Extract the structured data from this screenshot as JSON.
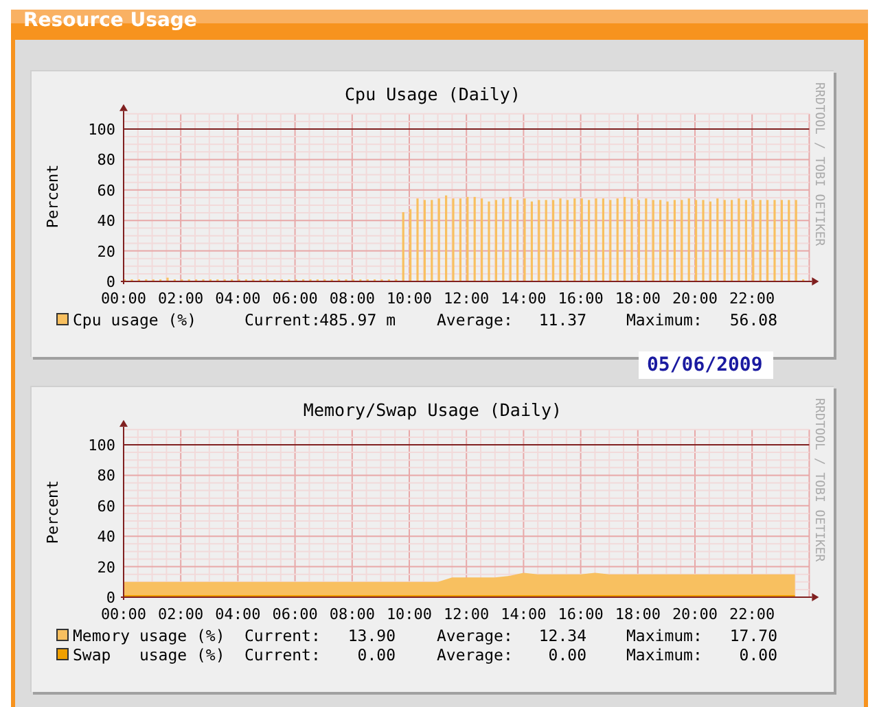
{
  "panel": {
    "title": "Resource Usage"
  },
  "graphs": [
    {
      "title": "Cpu Usage (Daily)",
      "watermark": "RRDTOOL / TOBI OETIKER",
      "date": "05/06/2009",
      "legend": [
        {
          "stats": [
            {
              "label": "Current:",
              "value": "485.97 m"
            },
            {
              "label": "Average:",
              "value": "11.37"
            },
            {
              "label": "Maximum:",
              "value": "56.08"
            }
          ]
        }
      ],
      "chart_data": {
        "type": "bar",
        "ylabel": "Percent",
        "grid": true,
        "legend": "bottom",
        "ref_lines": [
          {
            "axis": "y",
            "value": 100,
            "color": "#802020"
          }
        ],
        "xlim": [
          0,
          24
        ],
        "ylim": [
          0,
          110
        ],
        "yticks": [
          0,
          20,
          40,
          60,
          80,
          100
        ],
        "xticks": [
          {
            "value": 0,
            "label": "00:00"
          },
          {
            "value": 2,
            "label": "02:00"
          },
          {
            "value": 4,
            "label": "04:00"
          },
          {
            "value": 6,
            "label": "06:00"
          },
          {
            "value": 8,
            "label": "08:00"
          },
          {
            "value": 10,
            "label": "10:00"
          },
          {
            "value": 12,
            "label": "12:00"
          },
          {
            "value": 14,
            "label": "14:00"
          },
          {
            "value": 16,
            "label": "16:00"
          },
          {
            "value": 18,
            "label": "18:00"
          },
          {
            "value": 20,
            "label": "20:00"
          },
          {
            "value": 22,
            "label": "22:00"
          }
        ],
        "x": [
          0,
          0.25,
          0.5,
          0.75,
          1,
          1.25,
          1.5,
          1.75,
          2,
          2.25,
          2.5,
          2.75,
          3,
          3.25,
          3.5,
          3.75,
          4,
          4.25,
          4.5,
          4.75,
          5,
          5.25,
          5.5,
          5.75,
          6,
          6.25,
          6.5,
          6.75,
          7,
          7.25,
          7.5,
          7.75,
          8,
          8.25,
          8.5,
          8.75,
          9,
          9.25,
          9.5,
          9.75,
          10,
          10.25,
          10.5,
          10.75,
          11,
          11.25,
          11.5,
          11.75,
          12,
          12.25,
          12.5,
          12.75,
          13,
          13.25,
          13.5,
          13.75,
          14,
          14.25,
          14.5,
          14.75,
          15,
          15.25,
          15.5,
          15.75,
          16,
          16.25,
          16.5,
          16.75,
          17,
          17.25,
          17.5,
          17.75,
          18,
          18.25,
          18.5,
          18.75,
          19,
          19.25,
          19.5,
          19.75,
          20,
          20.25,
          20.5,
          20.75,
          21,
          21.25,
          21.5,
          21.75,
          22,
          22.25,
          22.5,
          22.75,
          23,
          23.25,
          23.5,
          23.75
        ],
        "series": [
          {
            "name": "Cpu usage (%)",
            "color": "#f8c060",
            "values": [
              0,
              0,
              0,
              0,
              0,
              0,
              2,
              0,
              0,
              0,
              0,
              0,
              0,
              0,
              0,
              0,
              0,
              0,
              0,
              0,
              0,
              0,
              0,
              0,
              0,
              0,
              0,
              0,
              0,
              0,
              0,
              0,
              0,
              0,
              0,
              0,
              0,
              0,
              0,
              45,
              47,
              54,
              53,
              53,
              54,
              56,
              54,
              54,
              55,
              55,
              54,
              52,
              53,
              54,
              55,
              53,
              54,
              52,
              53,
              53,
              53,
              54,
              53,
              54,
              54,
              53,
              54,
              54,
              53,
              54,
              55,
              54,
              53,
              54,
              53,
              53,
              52,
              53,
              53,
              54,
              53,
              53,
              52,
              54,
              53,
              53,
              54,
              53,
              53,
              53,
              53,
              53,
              53,
              53,
              53,
              0
            ]
          }
        ]
      }
    },
    {
      "title": "Memory/Swap Usage (Daily)",
      "watermark": "RRDTOOL / TOBI OETIKER",
      "legend": [
        {
          "stats": [
            {
              "label": "Current:",
              "value": "13.90"
            },
            {
              "label": "Average:",
              "value": "12.34"
            },
            {
              "label": "Maximum:",
              "value": "17.70"
            }
          ]
        },
        {
          "stats": [
            {
              "label": "Current:",
              "value": "0.00"
            },
            {
              "label": "Average:",
              "value": "0.00"
            },
            {
              "label": "Maximum:",
              "value": "0.00"
            }
          ]
        }
      ],
      "chart_data": {
        "type": "area",
        "ylabel": "Percent",
        "grid": true,
        "legend": "bottom",
        "ref_lines": [
          {
            "axis": "y",
            "value": 100,
            "color": "#802020"
          }
        ],
        "xlim": [
          0,
          24
        ],
        "ylim": [
          0,
          110
        ],
        "yticks": [
          0,
          20,
          40,
          60,
          80,
          100
        ],
        "xticks": [
          {
            "value": 0,
            "label": "00:00"
          },
          {
            "value": 2,
            "label": "02:00"
          },
          {
            "value": 4,
            "label": "04:00"
          },
          {
            "value": 6,
            "label": "06:00"
          },
          {
            "value": 8,
            "label": "08:00"
          },
          {
            "value": 10,
            "label": "10:00"
          },
          {
            "value": 12,
            "label": "12:00"
          },
          {
            "value": 14,
            "label": "14:00"
          },
          {
            "value": 16,
            "label": "16:00"
          },
          {
            "value": 18,
            "label": "18:00"
          },
          {
            "value": 20,
            "label": "20:00"
          },
          {
            "value": 22,
            "label": "22:00"
          }
        ],
        "x": [
          0,
          0.5,
          1,
          1.5,
          2,
          2.5,
          3,
          3.5,
          4,
          4.5,
          5,
          5.5,
          6,
          6.5,
          7,
          7.5,
          8,
          8.5,
          9,
          9.5,
          10,
          10.5,
          11,
          11.5,
          12,
          12.5,
          13,
          13.5,
          14,
          14.5,
          15,
          15.5,
          16,
          16.5,
          17,
          17.5,
          18,
          18.5,
          19,
          19.5,
          20,
          20.5,
          21,
          21.5,
          22,
          22.5,
          23,
          23.5
        ],
        "series": [
          {
            "name": "Memory usage (%)",
            "color": "#f8c060",
            "values": [
              10,
              10,
              10,
              10,
              10,
              10,
              10,
              10,
              10,
              10,
              10,
              10,
              10,
              10,
              10,
              10,
              10,
              10,
              10,
              10,
              10,
              10,
              10,
              13,
              13,
              13,
              13,
              14,
              16,
              15,
              15,
              15,
              15,
              16,
              15,
              15,
              15,
              15,
              15,
              15,
              15,
              15,
              15,
              15,
              15,
              15,
              15,
              15
            ]
          },
          {
            "name": "Swap   usage (%)",
            "color": "#f0a000",
            "values": [
              0,
              0,
              0,
              0,
              0,
              0,
              0,
              0,
              0,
              0,
              0,
              0,
              0,
              0,
              0,
              0,
              0,
              0,
              0,
              0,
              0,
              0,
              0,
              0,
              0,
              0,
              0,
              0,
              0,
              0,
              0,
              0,
              0,
              0,
              0,
              0,
              0,
              0,
              0,
              0,
              0,
              0,
              0,
              0,
              0,
              0,
              0,
              0
            ]
          }
        ]
      }
    }
  ]
}
